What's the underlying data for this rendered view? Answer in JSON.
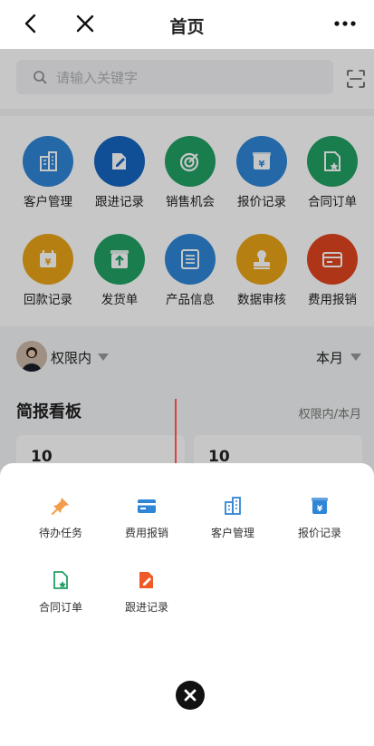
{
  "nav": {
    "title": "首页"
  },
  "search": {
    "placeholder": "请输入关键字"
  },
  "grid": [
    {
      "label": "客户管理",
      "color": "#2f86d6",
      "icon": "building-icon"
    },
    {
      "label": "跟进记录",
      "color": "#1565c0",
      "icon": "edit-note-icon"
    },
    {
      "label": "销售机会",
      "color": "#21a065",
      "icon": "target-icon"
    },
    {
      "label": "报价记录",
      "color": "#2f86d6",
      "icon": "yen-box-icon"
    },
    {
      "label": "合同订单",
      "color": "#21a065",
      "icon": "contract-icon"
    },
    {
      "label": "回款记录",
      "color": "#e8a318",
      "icon": "calendar-yen-icon"
    },
    {
      "label": "发货单",
      "color": "#21a065",
      "icon": "upload-box-icon"
    },
    {
      "label": "产品信息",
      "color": "#2f86d6",
      "icon": "list-icon"
    },
    {
      "label": "数据审核",
      "color": "#e8a318",
      "icon": "stamp-icon"
    },
    {
      "label": "费用报销",
      "color": "#e0451f",
      "icon": "card-icon"
    }
  ],
  "permission": {
    "scope": "权限内",
    "period": "本月"
  },
  "board": {
    "title": "简报看板",
    "subtitle": "权限内/本月",
    "cards": [
      "10",
      "10"
    ]
  },
  "sheet": {
    "items": [
      {
        "label": "待办任务",
        "color": "#f39c4a",
        "icon": "pin-icon"
      },
      {
        "label": "费用报销",
        "color": "#2f86d6",
        "icon": "card-icon"
      },
      {
        "label": "客户管理",
        "color": "#2f86d6",
        "icon": "building-icon"
      },
      {
        "label": "报价记录",
        "color": "#2f86d6",
        "icon": "yen-box-icon"
      },
      {
        "label": "合同订单",
        "color": "#21a065",
        "icon": "contract-icon"
      },
      {
        "label": "跟进记录",
        "color": "#f05a28",
        "icon": "edit-note-icon"
      }
    ]
  },
  "accent": {
    "arrow": "#e02020"
  }
}
